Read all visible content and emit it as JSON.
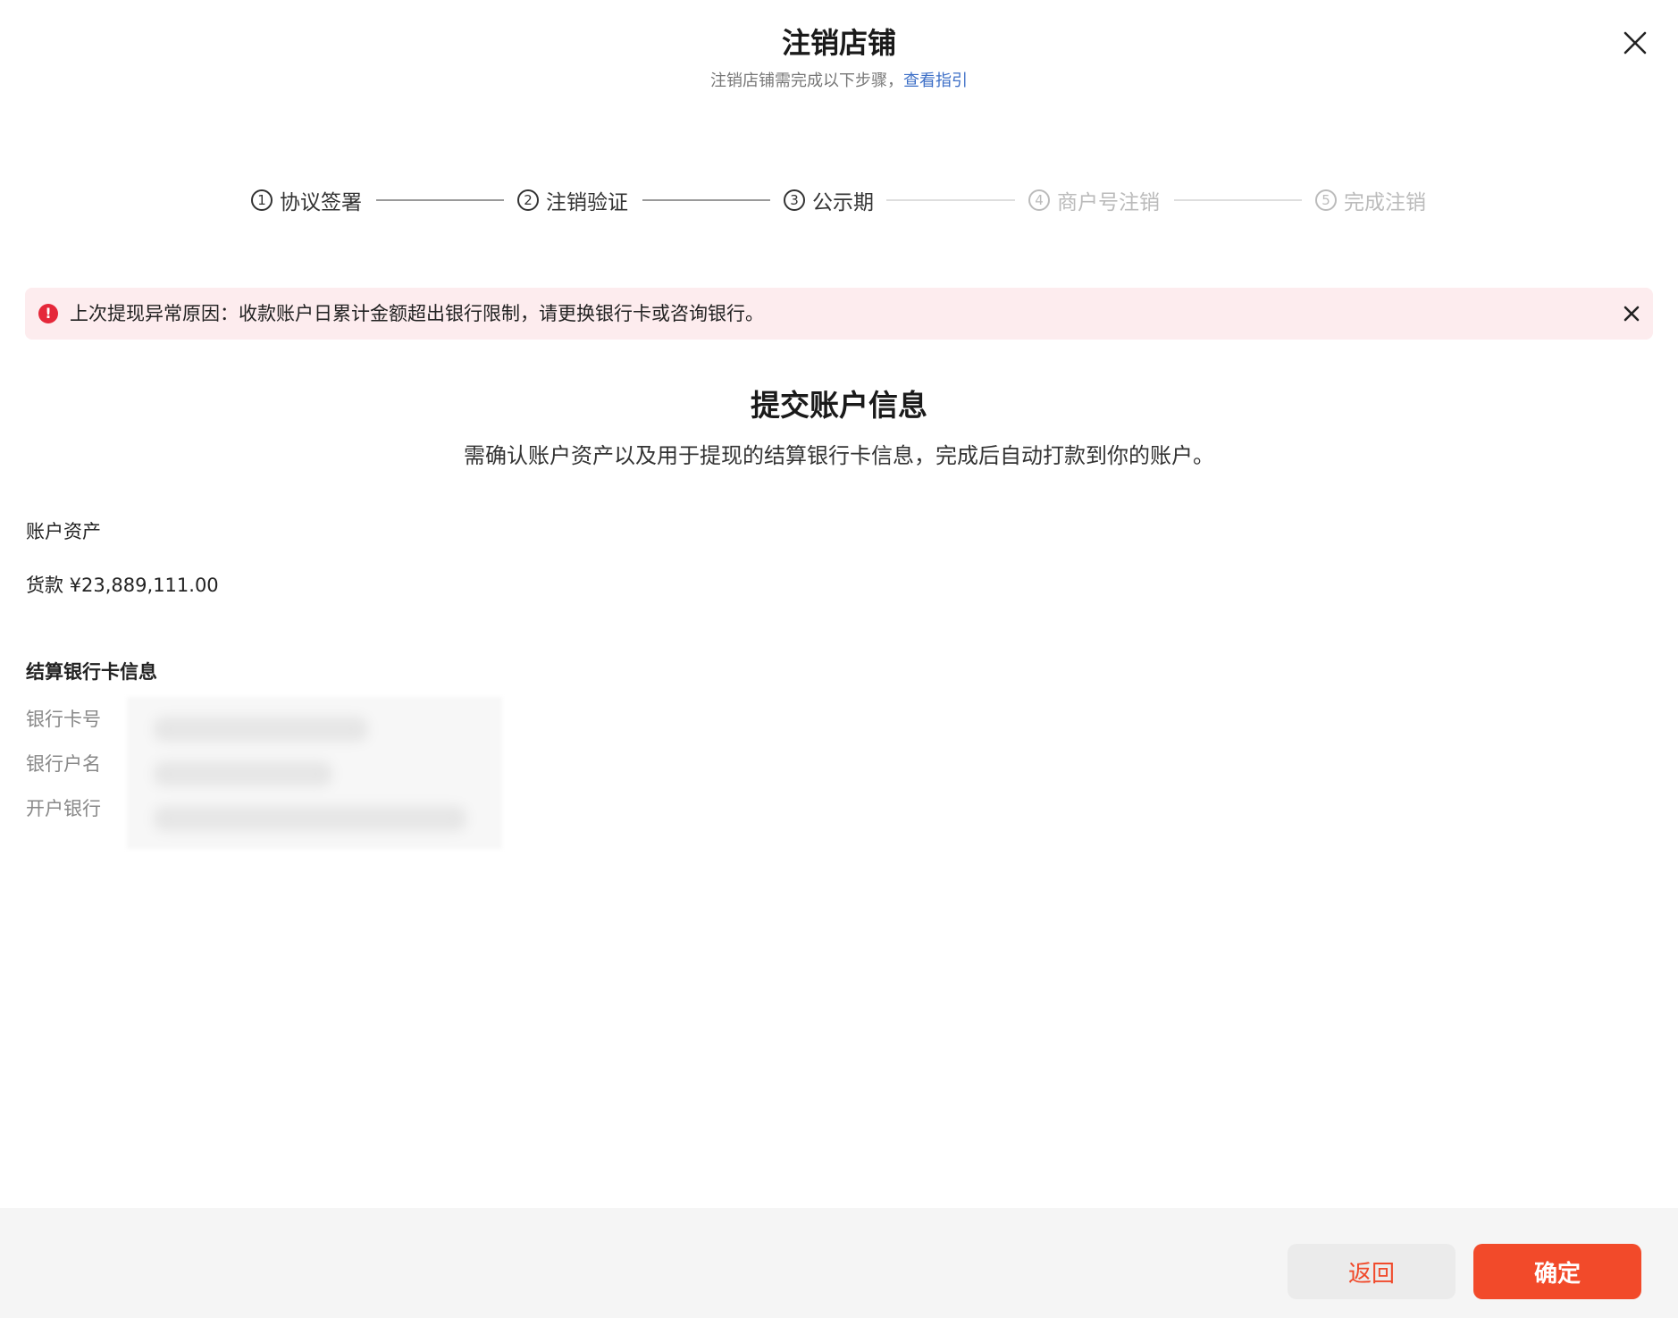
{
  "modal": {
    "title": "注销店铺",
    "subtitle_text": "注销店铺需完成以下步骤，",
    "guide_link": "查看指引"
  },
  "steps": [
    {
      "number": "1",
      "label": "协议签署",
      "status": "done"
    },
    {
      "number": "2",
      "label": "注销验证",
      "status": "done"
    },
    {
      "number": "3",
      "label": "公示期",
      "status": "current"
    },
    {
      "number": "4",
      "label": "商户号注销",
      "status": "pending"
    },
    {
      "number": "5",
      "label": "完成注销",
      "status": "pending"
    }
  ],
  "alert": {
    "icon": "error-icon",
    "text": "上次提现异常原因：收款账户日累计金额超出银行限制，请更换银行卡或咨询银行。",
    "color": "#e5283a",
    "background": "#fdecee"
  },
  "section": {
    "title": "提交账户信息",
    "description": "需确认账户资产以及用于提现的结算银行卡信息，完成后自动打款到你的账户。"
  },
  "assets": {
    "heading": "账户资产",
    "value_text": "货款 ¥23,889,111.00"
  },
  "bank": {
    "heading": "结算银行卡信息",
    "fields": [
      {
        "label": "银行卡号"
      },
      {
        "label": "银行户名"
      },
      {
        "label": "开户银行"
      }
    ]
  },
  "footer": {
    "back_label": "返回",
    "confirm_label": "确定",
    "accent_color": "#f24a2a"
  }
}
